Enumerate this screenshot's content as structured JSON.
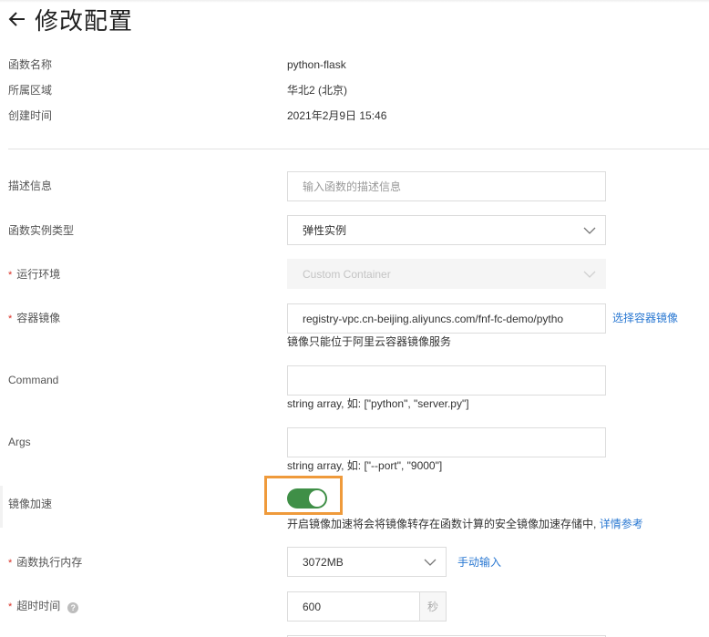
{
  "header": {
    "back_icon": "arrow-left-icon",
    "title": "修改配置"
  },
  "info": [
    {
      "label": "函数名称",
      "value": "python-flask"
    },
    {
      "label": "所属区域",
      "value": "华北2 (北京)"
    },
    {
      "label": "创建时间",
      "value": "2021年2月9日 15:46"
    }
  ],
  "form": {
    "description": {
      "label": "描述信息",
      "placeholder": "输入函数的描述信息",
      "value": ""
    },
    "instance_type": {
      "label": "函数实例类型",
      "value": "弹性实例"
    },
    "runtime": {
      "label": "运行环境",
      "required": "*",
      "value": "Custom Container",
      "disabled": true
    },
    "image": {
      "label": "容器镜像",
      "required": "*",
      "value": "registry-vpc.cn-beijing.aliyuncs.com/fnf-fc-demo/pytho",
      "action_link": "选择容器镜像",
      "hint": "镜像只能位于阿里云容器镜像服务"
    },
    "command": {
      "label": "Command",
      "value": "",
      "hint": "string array, 如: [\"python\", \"server.py\"]"
    },
    "args": {
      "label": "Args",
      "value": "",
      "hint": "string array, 如: [\"--port\", \"9000\"]"
    },
    "image_acceleration": {
      "label": "镜像加速",
      "enabled": true,
      "hint": "开启镜像加速将会将镜像转存在函数计算的安全镜像加速存储中,",
      "link": "详情参考"
    },
    "memory": {
      "label": "函数执行内存",
      "required": "*",
      "value": "3072MB",
      "action_link": "手动输入"
    },
    "timeout": {
      "label": "超时时间",
      "required": "*",
      "help_icon": "question-circle-icon",
      "help_glyph": "?",
      "value": "600",
      "unit": "秒"
    }
  },
  "colors": {
    "accent_link": "#2a78d2",
    "toggle_on": "#3f8f47",
    "highlight": "#ef9a3b",
    "required": "#d93026"
  }
}
